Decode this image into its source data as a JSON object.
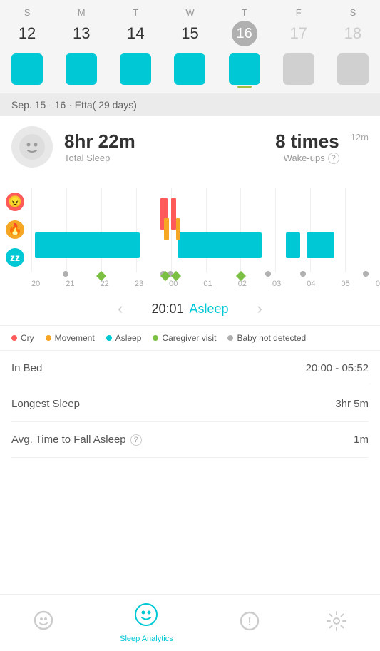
{
  "calendar": {
    "days": [
      {
        "label": "S",
        "number": "12",
        "today": false,
        "active": true,
        "faded": false
      },
      {
        "label": "M",
        "number": "13",
        "today": false,
        "active": true,
        "faded": false
      },
      {
        "label": "T",
        "number": "14",
        "today": false,
        "active": true,
        "faded": false
      },
      {
        "label": "W",
        "number": "15",
        "today": false,
        "active": true,
        "faded": false
      },
      {
        "label": "T",
        "number": "16",
        "today": true,
        "active": true,
        "faded": false
      },
      {
        "label": "F",
        "number": "17",
        "today": false,
        "active": false,
        "faded": true
      },
      {
        "label": "S",
        "number": "18",
        "today": false,
        "active": false,
        "faded": true
      }
    ]
  },
  "date_label": "Sep. 15 - 16 · Etta( 29 days)",
  "summary": {
    "total_sleep": "8hr 22m",
    "total_sleep_label": "Total Sleep",
    "wakeups": "8 times",
    "wakeups_label": "Wake-ups",
    "duration": "12m"
  },
  "chart": {
    "time_labels": [
      "20",
      "21",
      "22",
      "23",
      "00",
      "01",
      "02",
      "03",
      "04",
      "05",
      "0"
    ]
  },
  "navigation": {
    "time": "20:01",
    "status": "Asleep",
    "prev_label": "‹",
    "next_label": "›"
  },
  "legend": [
    {
      "color": "red",
      "label": "Cry"
    },
    {
      "color": "orange",
      "label": "Movement"
    },
    {
      "color": "teal",
      "label": "Asleep"
    },
    {
      "color": "green",
      "label": "Caregiver visit"
    },
    {
      "color": "gray",
      "label": "Baby not detected"
    }
  ],
  "stats": [
    {
      "label": "In Bed",
      "value": "20:00 - 05:52",
      "has_info": false
    },
    {
      "label": "Longest Sleep",
      "value": "3hr 5m",
      "has_info": false
    },
    {
      "label": "Avg. Time to Fall Asleep",
      "value": "1m",
      "has_info": true
    }
  ],
  "bottom_nav": [
    {
      "icon": "U",
      "label": "",
      "active": false,
      "name": "home"
    },
    {
      "icon": "😊",
      "label": "Sleep Analytics",
      "active": true,
      "name": "analytics"
    },
    {
      "icon": "!",
      "label": "",
      "active": false,
      "name": "alerts"
    },
    {
      "icon": "⚙",
      "label": "",
      "active": false,
      "name": "settings"
    }
  ]
}
